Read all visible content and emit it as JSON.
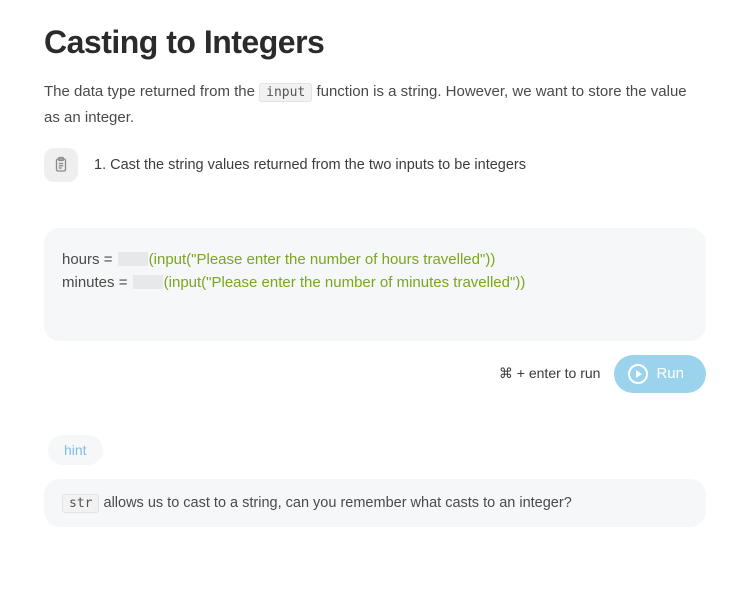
{
  "title": "Casting to Integers",
  "intro": {
    "before_code": "The data type returned from the ",
    "code": "input",
    "after_code": " function is a string. However, we want to store the value as an integer."
  },
  "task": {
    "text": "1. Cast the string values returned from the two inputs to be integers"
  },
  "code": {
    "line1": {
      "var": "hours",
      "eq": " = ",
      "open": "(",
      "fn": "input",
      "paren_open": "(",
      "str": "\"Please enter the number of hours travelled\"",
      "close": "))"
    },
    "line2": {
      "var": "minutes",
      "eq": " = ",
      "open": "(",
      "fn": "input",
      "paren_open": "(",
      "str": "\"Please enter the number of minutes travelled\"",
      "close": "))"
    }
  },
  "run": {
    "shortcut": "⌘ + enter to run",
    "label": "Run"
  },
  "hint": {
    "pill": "hint",
    "code": "str",
    "text": " allows us to cast to a string, can you remember what casts to an integer?"
  }
}
